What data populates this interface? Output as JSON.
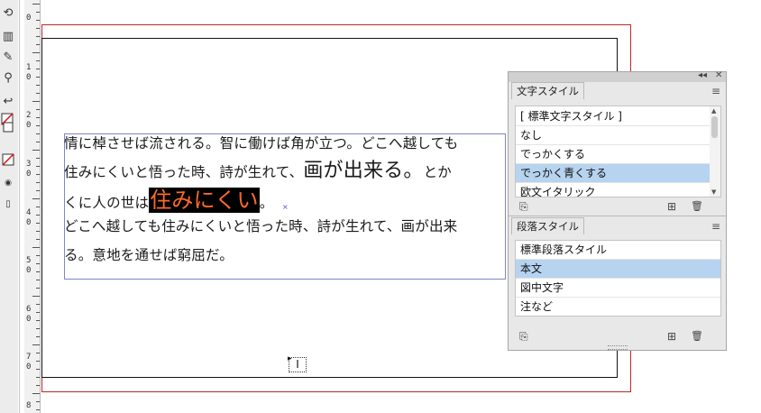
{
  "ruler": {
    "numbers": [
      "0",
      "1",
      "2",
      "3",
      "4",
      "5",
      "6",
      "7",
      "8"
    ],
    "sub": "0"
  },
  "document": {
    "lines": [
      {
        "segments": [
          {
            "text": "情に棹させば流される。智に働けば角が立つ。どこへ越しても",
            "style": "normal"
          }
        ]
      },
      {
        "segments": [
          {
            "text": "住みにくいと悟った時、詩が生れて、",
            "style": "normal"
          },
          {
            "text": "画が出来る。",
            "style": "big"
          },
          {
            "text": "とか",
            "style": "normal"
          }
        ]
      },
      {
        "segments": [
          {
            "text": "くに人の世は",
            "style": "normal"
          },
          {
            "text": "住みにくい",
            "style": "highlight"
          },
          {
            "text": "。",
            "style": "normal"
          }
        ]
      },
      {
        "segments": [
          {
            "text": "どこへ越しても住みにくいと悟った時、詩が生れて、画が出来",
            "style": "normal"
          }
        ]
      },
      {
        "segments": [
          {
            "text": "る。意地を通せば窮屈だ。",
            "style": "normal"
          }
        ]
      }
    ],
    "overflow_mark": "×",
    "cursor_glyph": "I",
    "highlight_color": "#ff6a2a"
  },
  "char_panel": {
    "title": "文字スタイル",
    "items": [
      "[ 標準文字スタイル ]",
      "なし",
      "でっかくする",
      "でっかく青くする",
      "欧文イタリック"
    ],
    "selected_index": 3
  },
  "para_panel": {
    "title": "段落スタイル",
    "items": [
      "標準段落スタイル",
      "本文",
      "図中文字",
      "注など"
    ],
    "selected_index": 1
  },
  "icons": {
    "collapse": "◂◂",
    "close": "✕",
    "menu": "≡",
    "new_style": "⊞",
    "delete": "🗑",
    "load": "⎘"
  },
  "colors": {
    "selection": "#b6d3ef",
    "bleed": "#b52a2a",
    "frame": "#7f86c8"
  }
}
